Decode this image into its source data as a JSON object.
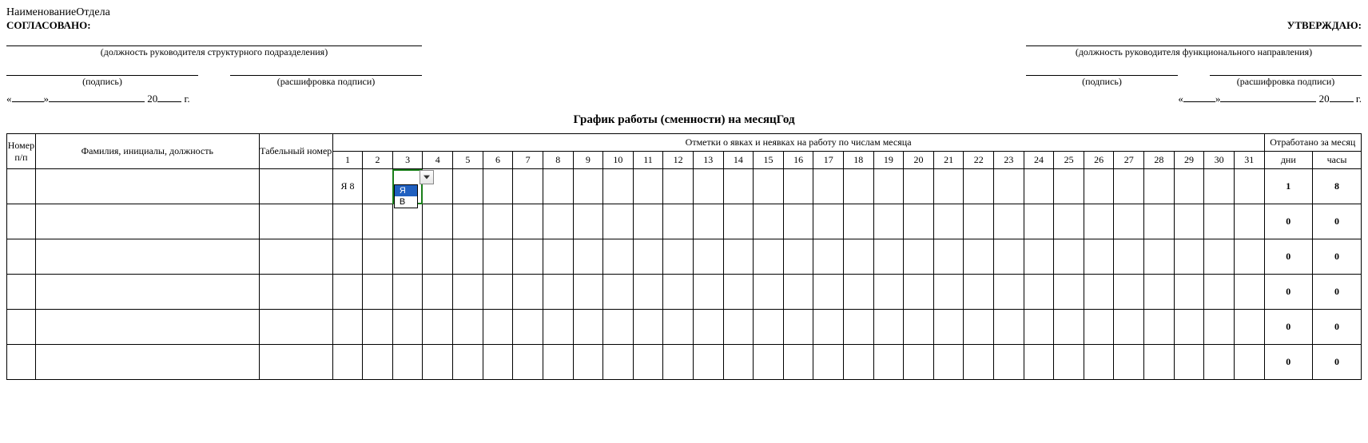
{
  "header": {
    "dept_name": "НаименованиеОтдела",
    "approved_left": "СОГЛАСОВАНО:",
    "approved_right": "УТВЕРЖДАЮ:",
    "sig_left_caption": "(должность руководителя структурного подразделения)",
    "sig_right_caption": "(должность руководителя функционального направления)",
    "signature_caption": "(подпись)",
    "decipher_caption": "(расшифровка подписи)",
    "date_prefix_quote_open": "«",
    "date_prefix_quote_close": "»",
    "date_year_prefix": "20",
    "date_year_suffix": "г."
  },
  "doc_title": "График работы (сменности) на месяцГод",
  "table": {
    "head": {
      "col_num": "Номеp п/п",
      "col_name": "Фамилия, инициалы, должность",
      "col_tab": "Табельный номер",
      "marks_header": "Отметки о явках и неявках на работу по числам месяца",
      "days": [
        "1",
        "2",
        "3",
        "4",
        "5",
        "6",
        "7",
        "8",
        "9",
        "10",
        "11",
        "12",
        "13",
        "14",
        "15",
        "16",
        "17",
        "18",
        "19",
        "20",
        "21",
        "22",
        "23",
        "24",
        "25",
        "26",
        "27",
        "28",
        "29",
        "30",
        "31"
      ],
      "total_header": "Отработано за месяц",
      "total_days": "дни",
      "total_hours": "часы"
    },
    "rows": [
      {
        "num": "",
        "name": "",
        "tab": "",
        "cells": [
          "Я 8",
          "",
          "",
          "",
          "",
          "",
          "",
          "",
          "",
          "",
          "",
          "",
          "",
          "",
          "",
          "",
          "",
          "",
          "",
          "",
          "",
          "",
          "",
          "",
          "",
          "",
          "",
          "",
          "",
          "",
          ""
        ],
        "days": "1",
        "hours": "8"
      },
      {
        "num": "",
        "name": "",
        "tab": "",
        "cells": [
          "",
          "",
          "",
          "",
          "",
          "",
          "",
          "",
          "",
          "",
          "",
          "",
          "",
          "",
          "",
          "",
          "",
          "",
          "",
          "",
          "",
          "",
          "",
          "",
          "",
          "",
          "",
          "",
          "",
          "",
          ""
        ],
        "days": "0",
        "hours": "0"
      },
      {
        "num": "",
        "name": "",
        "tab": "",
        "cells": [
          "",
          "",
          "",
          "",
          "",
          "",
          "",
          "",
          "",
          "",
          "",
          "",
          "",
          "",
          "",
          "",
          "",
          "",
          "",
          "",
          "",
          "",
          "",
          "",
          "",
          "",
          "",
          "",
          "",
          "",
          ""
        ],
        "days": "0",
        "hours": "0"
      },
      {
        "num": "",
        "name": "",
        "tab": "",
        "cells": [
          "",
          "",
          "",
          "",
          "",
          "",
          "",
          "",
          "",
          "",
          "",
          "",
          "",
          "",
          "",
          "",
          "",
          "",
          "",
          "",
          "",
          "",
          "",
          "",
          "",
          "",
          "",
          "",
          "",
          "",
          ""
        ],
        "days": "0",
        "hours": "0"
      },
      {
        "num": "",
        "name": "",
        "tab": "",
        "cells": [
          "",
          "",
          "",
          "",
          "",
          "",
          "",
          "",
          "",
          "",
          "",
          "",
          "",
          "",
          "",
          "",
          "",
          "",
          "",
          "",
          "",
          "",
          "",
          "",
          "",
          "",
          "",
          "",
          "",
          "",
          ""
        ],
        "days": "0",
        "hours": "0"
      },
      {
        "num": "",
        "name": "",
        "tab": "",
        "cells": [
          "",
          "",
          "",
          "",
          "",
          "",
          "",
          "",
          "",
          "",
          "",
          "",
          "",
          "",
          "",
          "",
          "",
          "",
          "",
          "",
          "",
          "",
          "",
          "",
          "",
          "",
          "",
          "",
          "",
          "",
          ""
        ],
        "days": "0",
        "hours": "0"
      }
    ]
  },
  "dropdown": {
    "options": [
      "Я",
      "В"
    ],
    "selected_index": 0
  }
}
